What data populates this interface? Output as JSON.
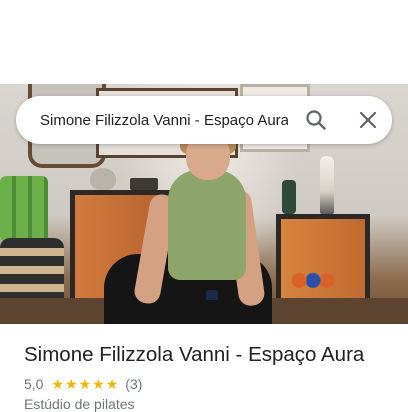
{
  "search": {
    "query": "Simone Filizzola Vanni - Espaço Aura"
  },
  "place": {
    "name": "Simone Filizzola Vanni - Espaço Aura",
    "rating": "5,0",
    "stars_filled": 5,
    "review_count": "(3)",
    "category": "Estúdio de pilates"
  },
  "colors": {
    "star": "#f4b400",
    "title_text": "#202124",
    "secondary_text": "#70757a"
  }
}
